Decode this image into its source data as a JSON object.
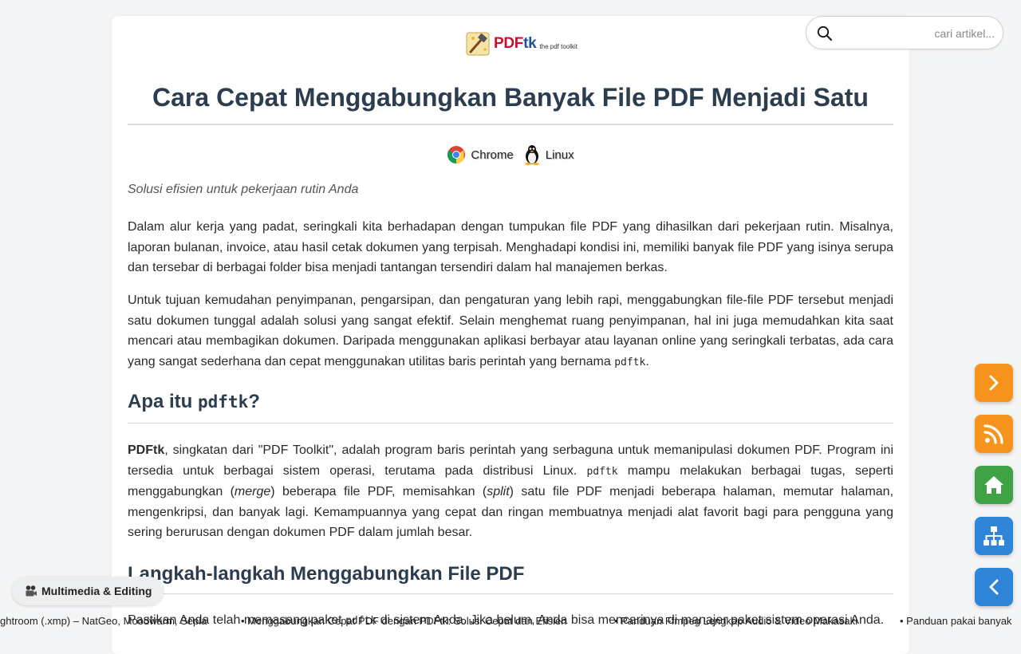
{
  "logo": {
    "brand_main": "PDF",
    "brand_accent": "tk",
    "tagline": "the pdf toolkit"
  },
  "article": {
    "title": "Cara Cepat Menggabungkan Banyak File PDF Menjadi Satu",
    "tags": [
      {
        "label": "Chrome",
        "icon": "chrome-icon"
      },
      {
        "label": "Linux",
        "icon": "linux-tux-icon"
      }
    ],
    "subtitle": "Solusi efisien untuk pekerjaan rutin Anda",
    "p1": "Dalam alur kerja yang padat, seringkali kita berhadapan dengan tumpukan file PDF yang dihasilkan dari pekerjaan rutin. Misalnya, laporan bulanan, invoice, atau hasil cetak dokumen yang terpisah. Menghadapi kondisi ini, memiliki banyak file PDF yang isinya serupa dan tersebar di berbagai folder bisa menjadi tantangan tersendiri dalam hal manajemen berkas.",
    "p2_text": "Untuk tujuan kemudahan penyimpanan, pengarsipan, dan pengaturan yang lebih rapi, menggabungkan file-file PDF tersebut menjadi satu dokumen tunggal adalah solusi yang sangat efektif. Selain menghemat ruang penyimpanan, hal ini juga memudahkan kita saat mencari atau membagikan dokumen. Daripada menggunakan aplikasi berbayar atau layanan online yang seringkali terbatas, ada cara yang sangat sederhana dan cepat menggunakan utilitas baris perintah yang bernama ",
    "p2_code": "pdftk",
    "p2_end": ".",
    "h2_1_prefix": "Apa itu ",
    "h2_1_code": "pdftk",
    "h2_1_suffix": "?",
    "p3_bold": "PDFtk",
    "p3_a": ", singkatan dari \"PDF Toolkit\", adalah program baris perintah yang serbaguna untuk memanipulasi dokumen PDF. Program ini tersedia untuk berbagai sistem operasi, terutama pada distribusi Linux. ",
    "p3_code": "pdftk",
    "p3_b": " mampu melakukan berbagai tugas, seperti menggabungkan (",
    "p3_merge": "merge",
    "p3_c": ") beberapa file PDF, memisahkan (",
    "p3_split": "split",
    "p3_d": ") satu file PDF menjadi beberapa halaman, memutar halaman, mengenkripsi, dan banyak lagi. Kemampuannya yang cepat dan ringan membuatnya menjadi alat favorit bagi para pengguna yang sering berurusan dengan dokumen PDF dalam jumlah besar.",
    "h2_2": "Langkah-langkah Menggabungkan File PDF",
    "p4_a": "Pastikan Anda telah memasang paket ",
    "p4_code": "pdftk",
    "p4_b": " di sistem Anda. Jika belum, Anda bisa mencarinya di manajer paket sistem operasi Anda."
  },
  "search": {
    "placeholder": "cari artikel..."
  },
  "side_buttons": [
    {
      "name": "next-button",
      "icon": "chevron-right-icon",
      "color": "#f7941d"
    },
    {
      "name": "rss-button",
      "icon": "rss-icon",
      "color": "#f7941d"
    },
    {
      "name": "home-button",
      "icon": "home-icon",
      "color": "#3fa244"
    },
    {
      "name": "sitemap-button",
      "icon": "sitemap-icon",
      "color": "#2f86d8"
    },
    {
      "name": "back-button",
      "icon": "chevron-left-icon",
      "color": "#2f86d8"
    }
  ],
  "category_chip": {
    "icon": "film-camera-icon",
    "label": "Multimedia & Editing"
  },
  "ticker": [
    "ghtroom (.xmp) – NatGeo, Moodwarm, Sepia",
    "• Menggabungkan Cepat PDF dengan PDFtk: Solusi Cepat dan Efisien",
    "• Panduan Ffmpeg Lengkap Audio & Video Makasaki",
    "• Panduan pakai banyak"
  ]
}
